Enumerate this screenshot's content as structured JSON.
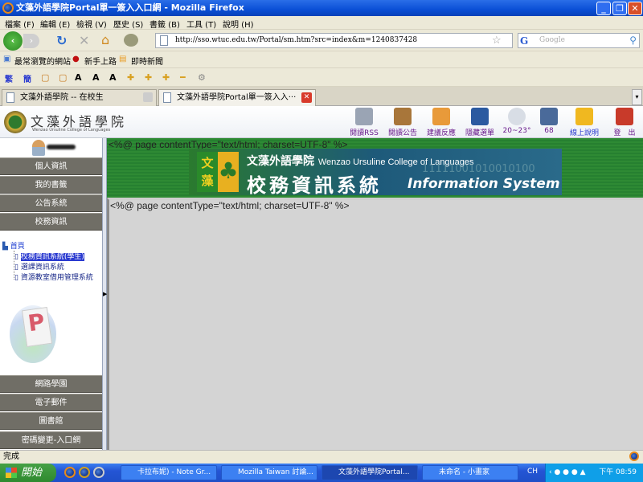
{
  "window": {
    "title": "文藻外語學院Portal單一簽入入口網 - Mozilla Firefox"
  },
  "menu": [
    "檔案 (F)",
    "編輯 (E)",
    "檢視 (V)",
    "歷史 (S)",
    "書籤 (B)",
    "工具 (T)",
    "說明 (H)"
  ],
  "nav": {
    "url": "http://sso.wtuc.edu.tw/Portal/sm.htm?src=index&m=1240837428",
    "search_placeholder": "Google"
  },
  "bookmarks": [
    "最常瀏覽的網站",
    "新手上路",
    "即時新聞"
  ],
  "ext_toolbar": [
    "繁",
    "簡"
  ],
  "tabs": [
    {
      "label": "文藻外語學院 -- 在校生",
      "active": false
    },
    {
      "label": "文藻外語學院Portal單一簽入入···",
      "active": true
    }
  ],
  "header": {
    "logo_text": "文藻外語學院",
    "logo_sub": "Wenzao Ursuline College of Languages",
    "icons": [
      {
        "label": "閱讀RSS",
        "color": "#9aa4b4"
      },
      {
        "label": "閱讀公告",
        "color": "#a8763a"
      },
      {
        "label": "建議反應",
        "color": "#e89a3a"
      },
      {
        "label": "隱藏選單",
        "color": "#2b5aa0"
      },
      {
        "label": "20~23°",
        "color": "#d8dde5"
      },
      {
        "label": "68",
        "color": "#4a6a9a"
      },
      {
        "label": "線上說明",
        "color": "#f0b820"
      },
      {
        "label": "登　出",
        "color": "#c83a2a"
      }
    ]
  },
  "sidebar": {
    "top_buttons": [
      "個人資訊",
      "我的書籤",
      "公告系統",
      "校務資訊"
    ],
    "tree": {
      "root": "首頁",
      "items": [
        "校務資訊系統(學生)",
        "選課資訊系統",
        "資源教室借用管理系統"
      ],
      "selected": 0
    },
    "portal_logo": "Portal",
    "bottom_buttons": [
      "網路學園",
      "電子郵件",
      "圖書館",
      "密碼變更-入口網"
    ]
  },
  "banner": {
    "code_text": "<%@ page contentType=\"text/html; charset=UTF-8\" %>",
    "school_cn": "文藻外語學院",
    "school_en": "Wenzao Ursuline College of Languages",
    "system_cn": "校務資訊系統",
    "system_en": "Information System",
    "logo_chars": "文藻",
    "binary": "11111001010010100"
  },
  "content": {
    "code_text": "<%@ page contentType=\"text/html; charset=UTF-8\" %>"
  },
  "status": "完成",
  "taskbar": {
    "start": "開始",
    "items": [
      {
        "label": "卡拉布妮) - Note Gr...",
        "active": false
      },
      {
        "label": "Mozilla Taiwan 討論...",
        "active": false
      },
      {
        "label": "文藻外語學院Portal...",
        "active": true
      },
      {
        "label": "未命名 - 小畫家",
        "active": false
      }
    ],
    "lang": "CH",
    "clock": "下午 08:59"
  }
}
